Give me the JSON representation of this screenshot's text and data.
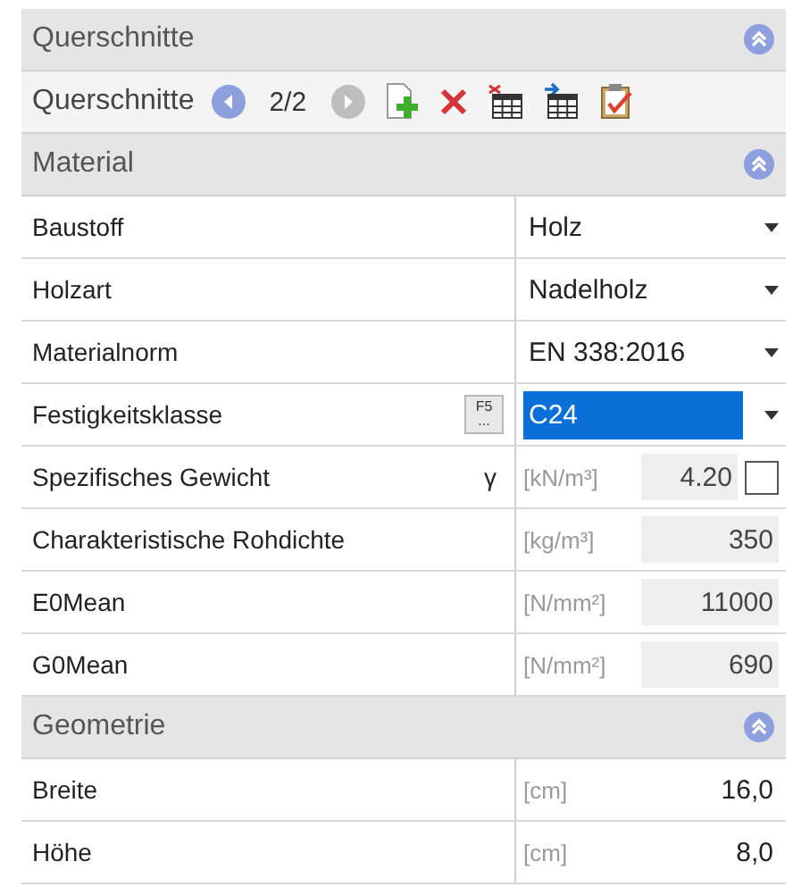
{
  "sections": [
    {
      "title": "Querschnitte",
      "expanded": true,
      "toolbar": {
        "label": "Querschnitte",
        "counter": "2/2",
        "prev_disabled": false,
        "next_disabled": true
      }
    },
    {
      "title": "Material",
      "expanded": true,
      "rows": [
        {
          "kind": "select",
          "label": "Baustoff",
          "value": "Holz",
          "selected": false
        },
        {
          "kind": "select",
          "label": "Holzart",
          "value": "Nadelholz",
          "selected": false
        },
        {
          "kind": "select",
          "label": "Materialnorm",
          "value": "EN 338:2016",
          "selected": false
        },
        {
          "kind": "select",
          "label": "Festigkeitsklasse",
          "value": "C24",
          "selected": true,
          "button_label": "F5",
          "button_dots": "..."
        },
        {
          "kind": "quantity",
          "label": "Spezifisches Gewicht",
          "symbol": "γ",
          "unit": "[kN/m³]",
          "value": "4.20",
          "readonly": true,
          "checked": false
        },
        {
          "kind": "quantity",
          "label": "Charakteristische Rohdichte",
          "unit": "[kg/m³]",
          "value": "350",
          "readonly": true
        },
        {
          "kind": "quantity",
          "label": "E0Mean",
          "unit": "[N/mm²]",
          "value": "11000",
          "readonly": true
        },
        {
          "kind": "quantity",
          "label": "G0Mean",
          "unit": "[N/mm²]",
          "value": "690",
          "readonly": true
        }
      ]
    },
    {
      "title": "Geometrie",
      "expanded": true,
      "rows": [
        {
          "kind": "quantity",
          "label": "Breite",
          "unit": "[cm]",
          "value": "16,0",
          "readonly": false
        },
        {
          "kind": "quantity",
          "label": "Höhe",
          "unit": "[cm]",
          "value": "8,0",
          "readonly": false
        }
      ]
    }
  ]
}
